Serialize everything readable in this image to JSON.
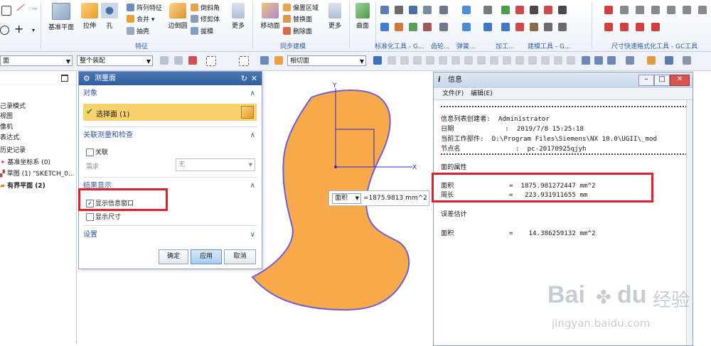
{
  "ribbon": {
    "big": [
      "基准平面",
      "拉伸",
      "孔",
      "边倒圆",
      "更多",
      "移动面",
      "更多",
      "曲面"
    ],
    "small": [
      "阵列特征",
      "合并",
      "抽壳",
      "倒斜角",
      "修剪体",
      "拔模",
      "偏置区域",
      "替换面",
      "删除面"
    ],
    "groups": [
      "特征",
      "同步建模",
      "标准化工具 - G...",
      "齿轮...",
      "弹簧...",
      "加工...",
      "建模工具 - G...",
      "尺寸快速格式化工具 - GC工具"
    ]
  },
  "toolbar": {
    "combo_filter": "面",
    "combo_assembly": "整个装配",
    "combo_section": "相切面"
  },
  "navigator": {
    "items": [
      "己录模式",
      "视图",
      "像机",
      "表达式",
      "历史记录",
      "基准坐标系 (0)",
      "草图 (1) \"SKETCH_0...",
      "有界平面 (2)"
    ]
  },
  "dialog": {
    "title": "测量面",
    "sec_object": "对象",
    "select_face": "选择面 (1)",
    "sec_assoc": "关联测量和检查",
    "assoc_label": "关联",
    "requirement_label": "需求",
    "requirement_value": "无",
    "sec_result": "结果显示",
    "show_info_window": "显示信息窗口",
    "show_dimension": "显示尺寸",
    "sec_settings": "设置",
    "ok": "确定",
    "apply": "应用",
    "cancel": "取消"
  },
  "canvas": {
    "axis_x": "X",
    "axis_y": "Y",
    "measure_type": "面积",
    "measure_value": "=1875.9813 mm^2",
    "shape_color": "#f8a94a",
    "edge_color": "#6a5fe0"
  },
  "info": {
    "title": "信息",
    "menu_file": "文件(F)",
    "menu_edit": "编辑(E)",
    "creator": "信息列表创建者:  Administrator",
    "date": "日期             :  2019/7/8 15:25:18",
    "workpart": "当前工作部件:  D:\\Program Files\\Siemens\\NX 10.0\\UGII\\_mod",
    "node": "节点名              :  pc-20170925qjyh",
    "face_props": "面的属性",
    "area_line": "面积              =  1875.981272447 mm^2",
    "perimeter_line": "周长              =   223.931911655 mm",
    "error_est": "误差估计",
    "error_area_line": "面积              =    14.386259132 mm^2"
  },
  "watermark": {
    "brand": "Bai",
    "brand2": "du",
    "label": "经验",
    "url": "jingyan.baidu.com"
  }
}
